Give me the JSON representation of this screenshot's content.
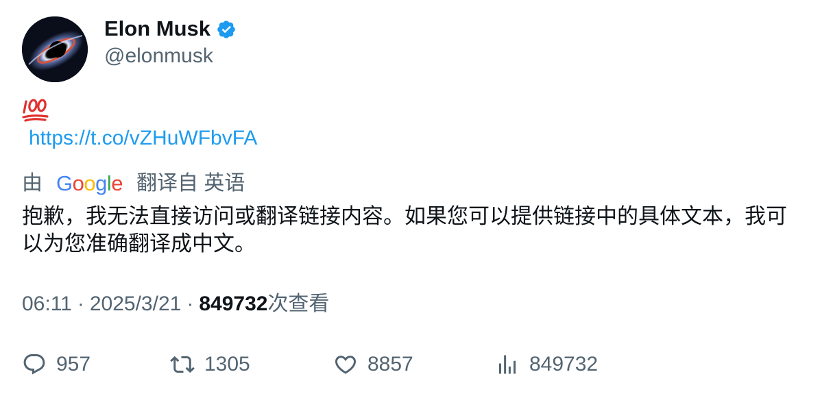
{
  "author": {
    "name": "Elon Musk",
    "handle": "@elonmusk",
    "verified": true
  },
  "tweet": {
    "emoji": "💯",
    "link": "https://t.co/vZHuWFbvFA"
  },
  "translation": {
    "prefix": "由",
    "provider_letters": [
      "G",
      "o",
      "o",
      "g",
      "l",
      "e"
    ],
    "suffix": "翻译自 英语",
    "text": "抱歉，我无法直接访问或翻译链接内容。如果您可以提供链接中的具体文本，我可以为您准确翻译成中文。"
  },
  "meta": {
    "time": "06:11",
    "sep1": "·",
    "date": "2025/3/21",
    "sep2": "·",
    "views": "849732",
    "views_label": "次查看"
  },
  "actions": {
    "replies": "957",
    "retweets": "1305",
    "likes": "8857",
    "views": "849732"
  },
  "colors": {
    "text": "#0f1419",
    "secondary": "#536471",
    "link": "#1d9bf0",
    "verified": "#1d9bf0"
  }
}
